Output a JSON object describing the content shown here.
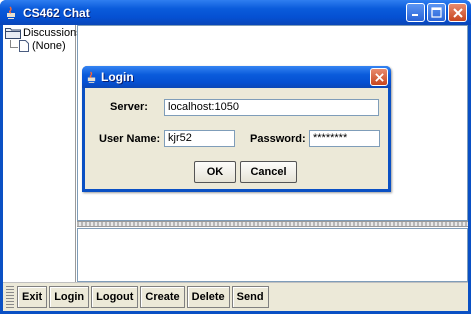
{
  "window": {
    "title": "CS462 Chat",
    "accent": "#0a50c4"
  },
  "tree": {
    "root_label": "Discussions",
    "root_icon": "folder-icon",
    "children": [
      {
        "label": "(None)",
        "icon": "leaf-icon"
      }
    ]
  },
  "toolbar": {
    "buttons": [
      {
        "label": "Exit"
      },
      {
        "label": "Login"
      },
      {
        "label": "Logout"
      },
      {
        "label": "Create"
      },
      {
        "label": "Delete"
      },
      {
        "label": "Send"
      }
    ]
  },
  "login_dialog": {
    "title": "Login",
    "server_label": "Server:",
    "server_value": "localhost:1050",
    "username_label": "User Name:",
    "username_value": "kjr52",
    "password_label": "Password:",
    "password_value": "********",
    "ok_label": "OK",
    "cancel_label": "Cancel"
  }
}
